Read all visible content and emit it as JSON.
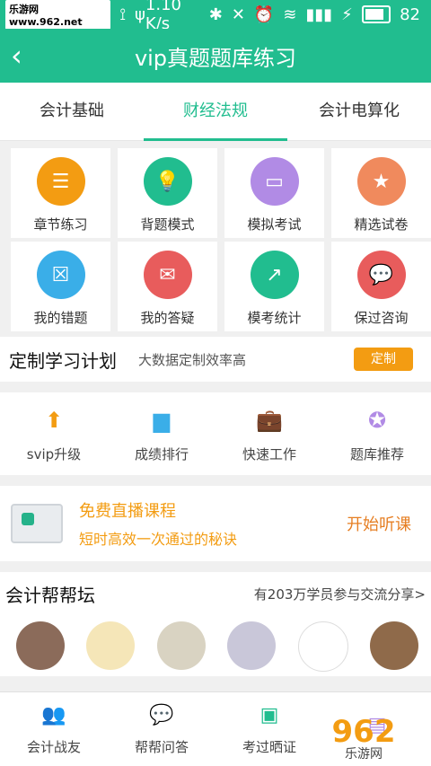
{
  "statusbar": {
    "watermark": "乐游网 www.962.net",
    "signal_text": "1.10 K/s",
    "battery": "82"
  },
  "header": {
    "title": "vip真题题库练习"
  },
  "tabs": [
    {
      "label": "会计基础"
    },
    {
      "label": "财经法规"
    },
    {
      "label": "会计电算化"
    }
  ],
  "grid": [
    {
      "label": "章节练习",
      "icon": "list-icon",
      "color": "#f39c12"
    },
    {
      "label": "背题模式",
      "icon": "lightbulb-icon",
      "color": "#21bd8f"
    },
    {
      "label": "模拟考试",
      "icon": "monitor-icon",
      "color": "#b18be5"
    },
    {
      "label": "精选试卷",
      "icon": "star-badge-icon",
      "color": "#f08a5d"
    },
    {
      "label": "我的错题",
      "icon": "error-doc-icon",
      "color": "#3aaee8"
    },
    {
      "label": "我的答疑",
      "icon": "chat-doc-icon",
      "color": "#e85c5c"
    },
    {
      "label": "模考统计",
      "icon": "chart-up-icon",
      "color": "#21bd8f"
    },
    {
      "label": "保过咨询",
      "icon": "chat-bubble-icon",
      "color": "#e85c5c"
    }
  ],
  "plan": {
    "title": "定制学习计划",
    "subtitle": "大数据定制效率高",
    "button": "定制"
  },
  "features": [
    {
      "label": "svip升级",
      "icon": "upgrade-icon",
      "color": "#f39c12"
    },
    {
      "label": "成绩排行",
      "icon": "bar-rank-icon",
      "color": "#3aaee8"
    },
    {
      "label": "快速工作",
      "icon": "briefcase-icon",
      "color": "#21bd8f"
    },
    {
      "label": "题库推荐",
      "icon": "recommend-badge-icon",
      "color": "#b18be5"
    }
  ],
  "live": {
    "title": "免费直播课程",
    "subtitle": "短时高效一次通过的秘诀",
    "button": "开始听课"
  },
  "forum": {
    "title": "会计帮帮坛",
    "more": "有203万学员参与交流分享>"
  },
  "bottomnav": [
    {
      "label": "会计战友",
      "icon": "friends-icon"
    },
    {
      "label": "帮帮问答",
      "icon": "qa-icon"
    },
    {
      "label": "考过晒证",
      "icon": "certificate-icon"
    },
    {
      "label": "",
      "icon": "board-icon"
    }
  ],
  "watermark_logo": {
    "text": "962",
    "sub": "乐游网"
  }
}
